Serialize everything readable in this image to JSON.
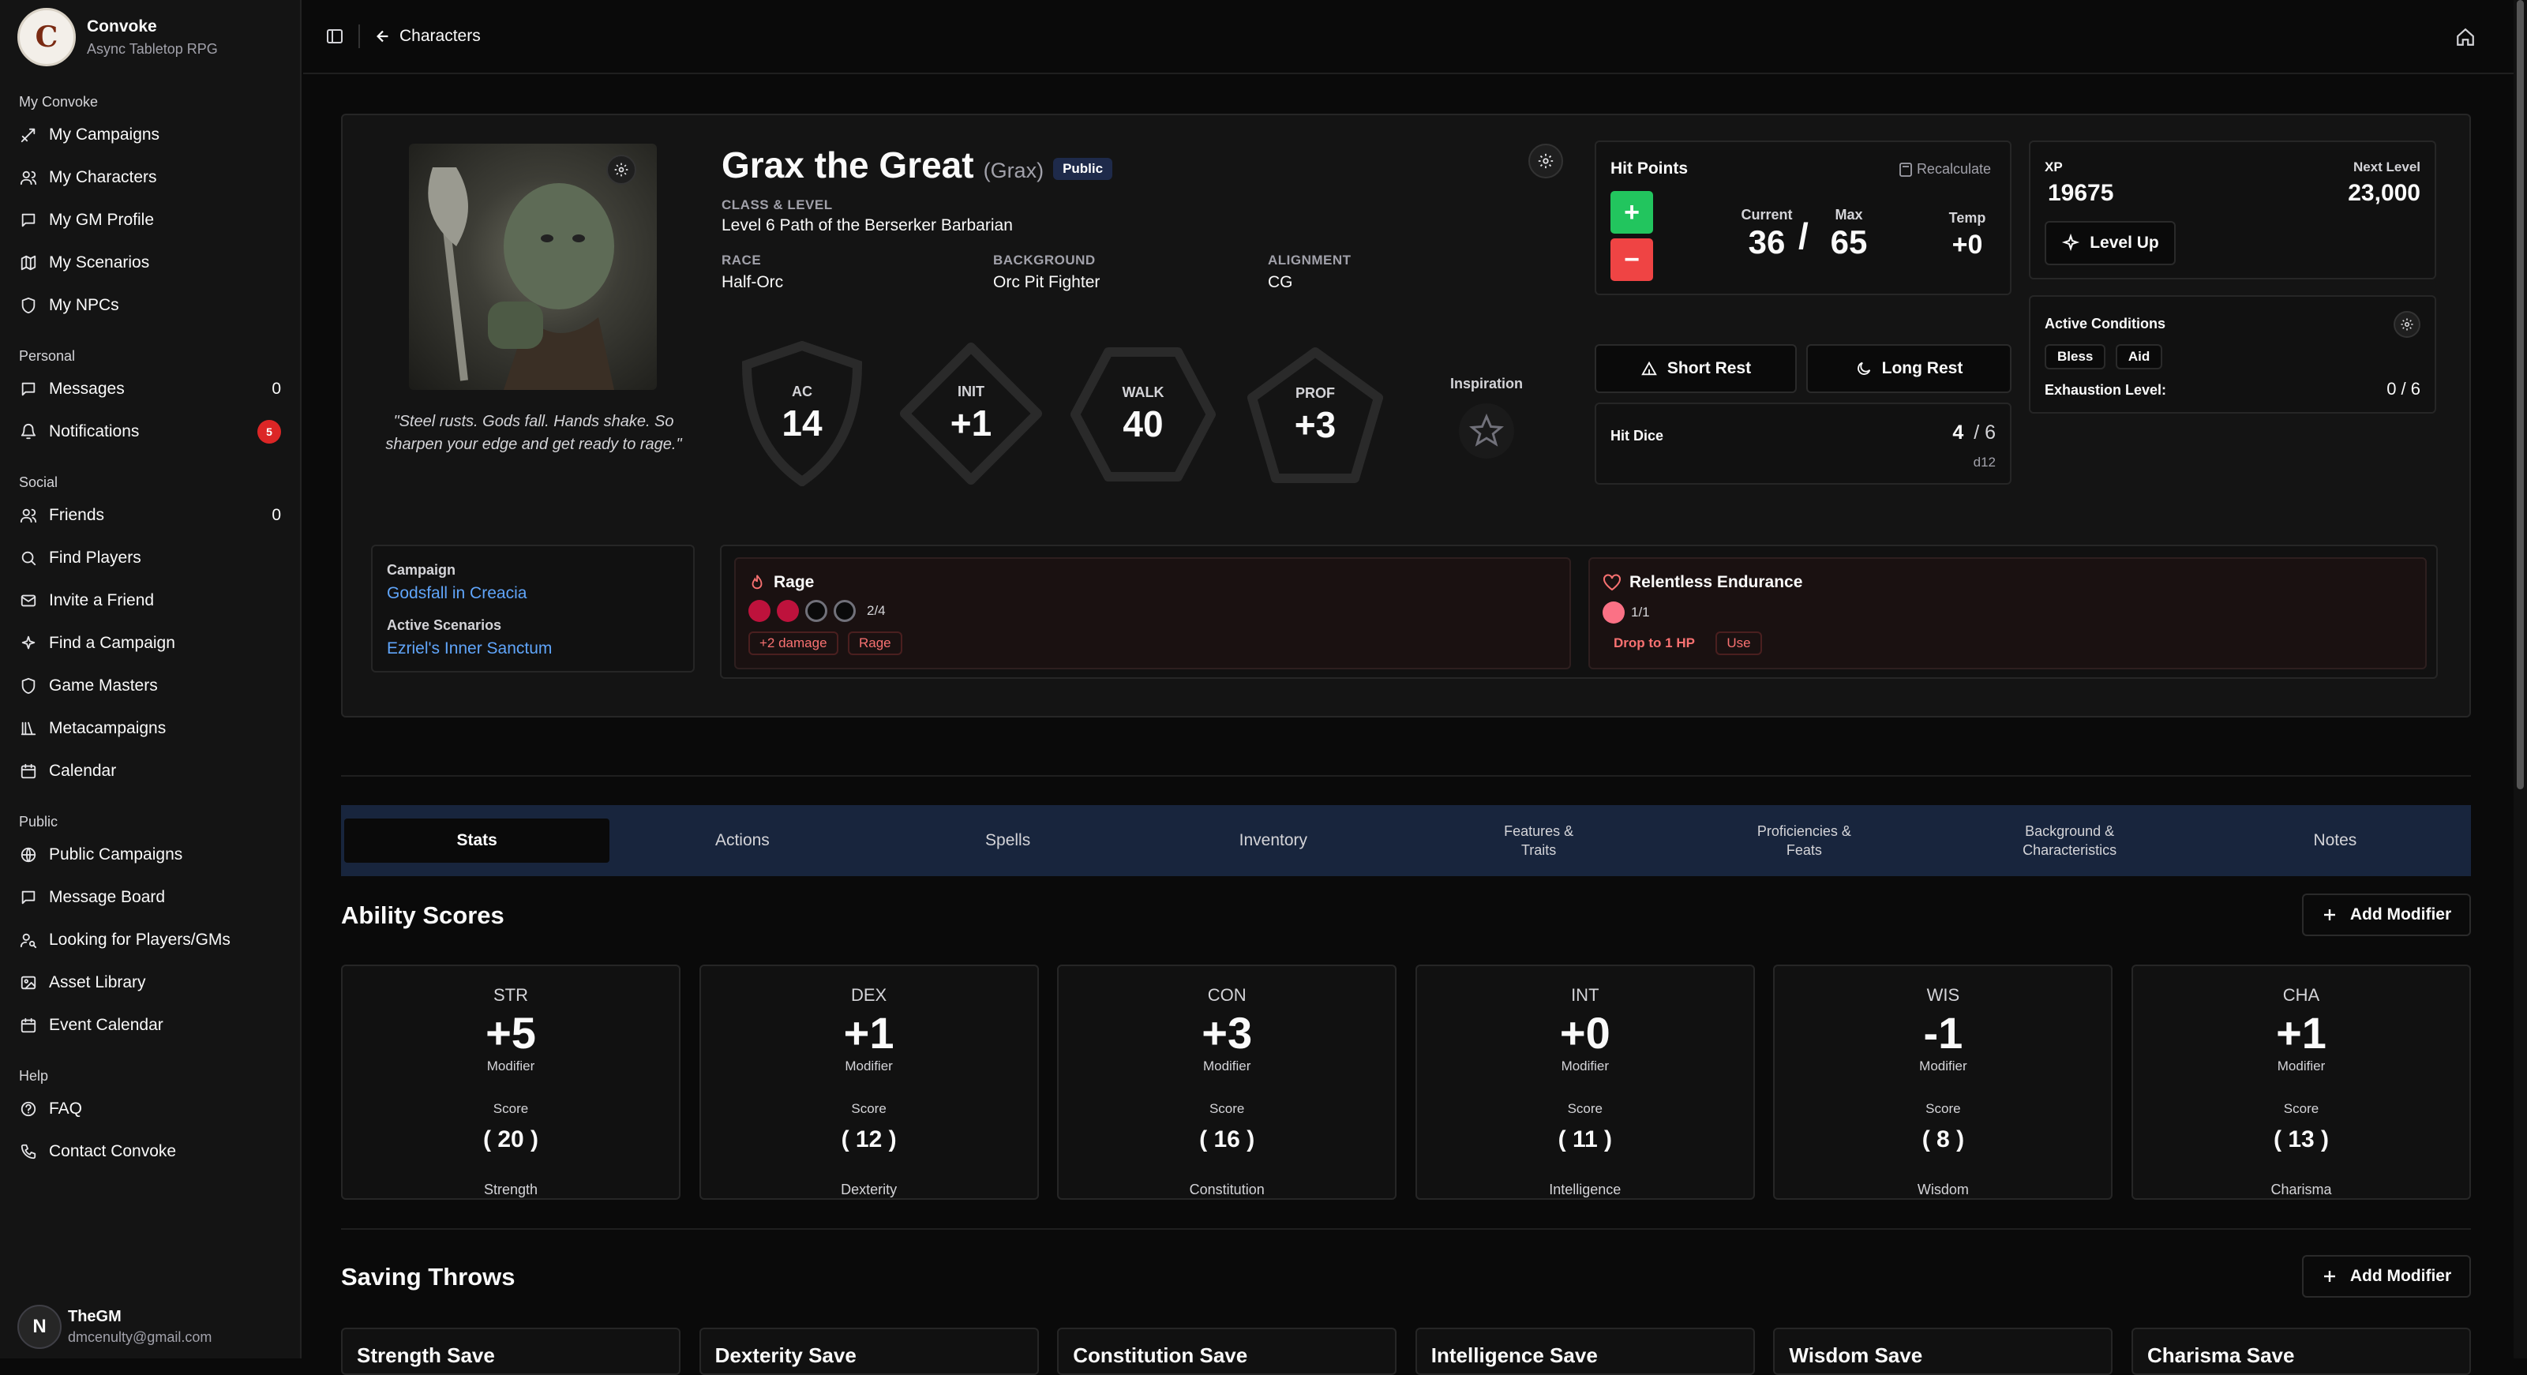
{
  "sidebar": {
    "brand_title": "Convoke",
    "brand_sub": "Async Tabletop RPG",
    "sections": [
      {
        "label": "My Convoke",
        "items": [
          {
            "label": "My Campaigns",
            "icon": "swords-icon"
          },
          {
            "label": "My Characters",
            "icon": "users-icon"
          },
          {
            "label": "My GM Profile",
            "icon": "message-icon"
          },
          {
            "label": "My Scenarios",
            "icon": "map-icon"
          },
          {
            "label": "My NPCs",
            "icon": "shield-icon"
          }
        ]
      },
      {
        "label": "Personal",
        "items": [
          {
            "label": "Messages",
            "icon": "message-icon",
            "count": "0"
          },
          {
            "label": "Notifications",
            "icon": "bell-icon",
            "badge": "5"
          }
        ]
      },
      {
        "label": "Social",
        "items": [
          {
            "label": "Friends",
            "icon": "users-icon",
            "count": "0"
          },
          {
            "label": "Find Players",
            "icon": "search-icon"
          },
          {
            "label": "Invite a Friend",
            "icon": "mail-icon"
          },
          {
            "label": "Find a Campaign",
            "icon": "sparkle-icon"
          },
          {
            "label": "Game Masters",
            "icon": "shield-icon"
          },
          {
            "label": "Metacampaigns",
            "icon": "library-icon"
          },
          {
            "label": "Calendar",
            "icon": "calendar-icon"
          }
        ]
      },
      {
        "label": "Public",
        "items": [
          {
            "label": "Public Campaigns",
            "icon": "globe-icon"
          },
          {
            "label": "Message Board",
            "icon": "message-icon"
          },
          {
            "label": "Looking for Players/GMs",
            "icon": "user-search-icon"
          },
          {
            "label": "Asset Library",
            "icon": "image-icon"
          },
          {
            "label": "Event Calendar",
            "icon": "calendar-icon"
          }
        ]
      },
      {
        "label": "Help",
        "items": [
          {
            "label": "FAQ",
            "icon": "help-icon"
          },
          {
            "label": "Contact Convoke",
            "icon": "phone-icon"
          }
        ]
      }
    ],
    "user": {
      "initial": "N",
      "name": "TheGM",
      "email": "dmcenulty@gmail.com"
    }
  },
  "topbar": {
    "back_label": "Characters"
  },
  "character": {
    "name": "Grax the Great",
    "nickname": "(Grax)",
    "visibility": "Public",
    "class_label": "CLASS & LEVEL",
    "class_value": "Level 6 Path of the Berserker Barbarian",
    "race_label": "RACE",
    "race": "Half-Orc",
    "background_label": "BACKGROUND",
    "background": "Orc Pit Fighter",
    "alignment_label": "ALIGNMENT",
    "alignment": "CG",
    "quote": "\"Steel rusts. Gods fall. Hands shake. So sharpen your edge and get ready to rage.\"",
    "stats": [
      {
        "label": "AC",
        "value": "14"
      },
      {
        "label": "INIT",
        "value": "+1"
      },
      {
        "label": "WALK",
        "value": "40"
      },
      {
        "label": "PROF",
        "value": "+3"
      }
    ],
    "inspiration_label": "Inspiration"
  },
  "hit_points": {
    "title": "Hit Points",
    "recalc": "Recalculate",
    "current_label": "Current",
    "current": "36",
    "slash": "/",
    "max_label": "Max",
    "max": "65",
    "temp_label": "Temp",
    "temp": "+0",
    "plus": "+",
    "minus": "−"
  },
  "rest": {
    "short": "Short Rest",
    "long": "Long Rest"
  },
  "hit_dice": {
    "label": "Hit Dice",
    "current": "4",
    "total": "/ 6",
    "die": "d12"
  },
  "xp": {
    "label": "XP",
    "value": "19675",
    "next_label": "Next Level",
    "next_value": "23,000",
    "level_up": "Level Up"
  },
  "conditions": {
    "label": "Active Conditions",
    "chips": [
      "Bless",
      "Aid"
    ],
    "exhaustion_label": "Exhaustion Level:",
    "exhaustion_value": "0 / 6"
  },
  "campaign": {
    "label": "Campaign",
    "name": "Godsfall in Creacia",
    "scen_label": "Active Scenarios",
    "scenario": "Ezriel's Inner Sanctum"
  },
  "rage": {
    "title": "Rage",
    "used": 2,
    "total": 4,
    "count": "2/4",
    "tag1": "+2 damage",
    "tag2": "Rage"
  },
  "endurance": {
    "title": "Relentless Endurance",
    "count": "1/1",
    "tag1": "Drop to 1 HP",
    "tag2": "Use"
  },
  "tabs": [
    "Stats",
    "Actions",
    "Spells",
    "Inventory",
    "Features &\nTraits",
    "Proficiencies &\nFeats",
    "Background &\nCharacteristics",
    "Notes"
  ],
  "ability_section": {
    "title": "Ability Scores",
    "add_modifier": "Add Modifier"
  },
  "abilities": [
    {
      "abbr": "STR",
      "mod": "+5",
      "score": "20",
      "name": "Strength"
    },
    {
      "abbr": "DEX",
      "mod": "+1",
      "score": "12",
      "name": "Dexterity"
    },
    {
      "abbr": "CON",
      "mod": "+3",
      "score": "16",
      "name": "Constitution"
    },
    {
      "abbr": "INT",
      "mod": "+0",
      "score": "11",
      "name": "Intelligence"
    },
    {
      "abbr": "WIS",
      "mod": "-1",
      "score": "8",
      "name": "Wisdom"
    },
    {
      "abbr": "CHA",
      "mod": "+1",
      "score": "13",
      "name": "Charisma"
    }
  ],
  "ability_labels": {
    "modifier": "Modifier",
    "score": "Score",
    "open": "(",
    "close": ")"
  },
  "saving_section": {
    "title": "Saving Throws",
    "add_modifier": "Add Modifier"
  },
  "saves": [
    "Strength Save",
    "Dexterity Save",
    "Constitution Save",
    "Intelligence Save",
    "Wisdom Save",
    "Charisma Save"
  ],
  "colors": {
    "accent_blue": "#60a5fa",
    "hp_plus": "#22c55e",
    "hp_minus": "#ef4444",
    "rage_dot": "#be123c",
    "tab_bar": "#18253d"
  }
}
